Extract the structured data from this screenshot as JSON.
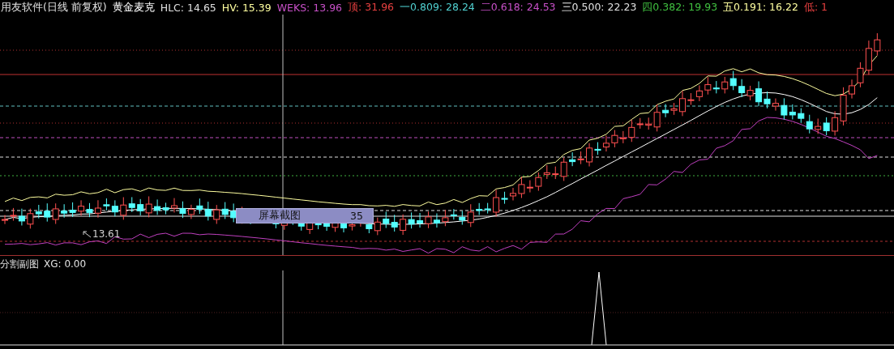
{
  "header": {
    "title": "用友软件(日线 前复权)",
    "indicator": "黄金麦克",
    "legend": [
      {
        "text": "HLC: 14.65",
        "color": "#e0e0e0"
      },
      {
        "text": "HV: 15.39",
        "color": "#ffffa0"
      },
      {
        "text": "WEKS: 13.96",
        "color": "#c850c8"
      },
      {
        "text": "顶: 31.96",
        "color": "#e84040"
      },
      {
        "text": "一0.809: 28.24",
        "color": "#50d0d0"
      },
      {
        "text": "二0.618: 24.53",
        "color": "#c850c8"
      },
      {
        "text": "三0.500: 22.23",
        "color": "#e0e0e0"
      },
      {
        "text": "四0.382: 19.93",
        "color": "#40c040"
      },
      {
        "text": "五0.191: 16.22",
        "color": "#ffffa0"
      },
      {
        "text": "低: 1",
        "color": "#e84040"
      }
    ]
  },
  "main_chart": {
    "low_marker": "13.61",
    "popup": {
      "label": "屏幕截图",
      "value": "35"
    }
  },
  "sub_chart": {
    "title": "分割副图",
    "reading": "XG: 0.00"
  }
}
